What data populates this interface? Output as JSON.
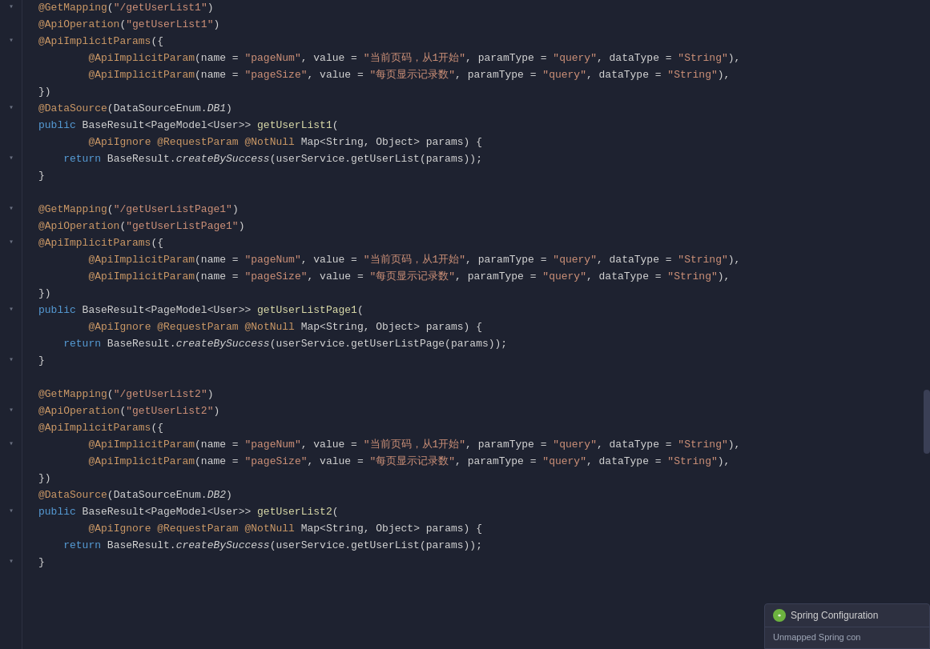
{
  "editor": {
    "background": "#1e2230",
    "lines": [
      {
        "id": 1,
        "fold": true,
        "tokens": [
          {
            "t": "annotation-name",
            "v": "@GetMapping"
          },
          {
            "t": "plain",
            "v": "("
          },
          {
            "t": "string",
            "v": "\""
          },
          {
            "t": "string",
            "v": "/getUserList1"
          },
          {
            "t": "string",
            "v": "\""
          },
          {
            "t": "plain",
            "v": ")"
          }
        ]
      },
      {
        "id": 2,
        "fold": false,
        "tokens": [
          {
            "t": "annotation-name",
            "v": "@ApiOperation"
          },
          {
            "t": "plain",
            "v": "("
          },
          {
            "t": "string",
            "v": "\""
          },
          {
            "t": "string",
            "v": "getUserList1"
          },
          {
            "t": "string",
            "v": "\""
          },
          {
            "t": "plain",
            "v": ")"
          }
        ]
      },
      {
        "id": 3,
        "fold": true,
        "tokens": [
          {
            "t": "annotation-name",
            "v": "@ApiImplicitParams"
          },
          {
            "t": "plain",
            "v": "({"
          }
        ]
      },
      {
        "id": 4,
        "fold": false,
        "tokens": [
          {
            "t": "plain",
            "v": "        "
          },
          {
            "t": "annotation-name",
            "v": "@ApiImplicitParam"
          },
          {
            "t": "plain",
            "v": "(name = "
          },
          {
            "t": "string",
            "v": "\"pageNum\""
          },
          {
            "t": "plain",
            "v": ", value = "
          },
          {
            "t": "cn-string",
            "v": "\"当前页码，从1开始\""
          },
          {
            "t": "plain",
            "v": ", paramType = "
          },
          {
            "t": "string",
            "v": "\"query\""
          },
          {
            "t": "plain",
            "v": ", dataType = "
          },
          {
            "t": "string",
            "v": "\"String\""
          },
          {
            "t": "plain",
            "v": ")，"
          }
        ]
      },
      {
        "id": 5,
        "fold": false,
        "tokens": [
          {
            "t": "plain",
            "v": "        "
          },
          {
            "t": "annotation-name",
            "v": "@ApiImplicitParam"
          },
          {
            "t": "plain",
            "v": "(name = "
          },
          {
            "t": "string",
            "v": "\"pageSize\""
          },
          {
            "t": "plain",
            "v": ", value = "
          },
          {
            "t": "cn-string",
            "v": "\"每页显示记录数\""
          },
          {
            "t": "plain",
            "v": ", paramType = "
          },
          {
            "t": "string",
            "v": "\"query\""
          },
          {
            "t": "plain",
            "v": ", dataType = "
          },
          {
            "t": "string",
            "v": "\"String\""
          },
          {
            "t": "plain",
            "v": ")，"
          }
        ]
      },
      {
        "id": 6,
        "fold": false,
        "tokens": [
          {
            "t": "plain",
            "v": "})"
          }
        ]
      },
      {
        "id": 7,
        "fold": false,
        "tokens": [
          {
            "t": "annotation-name",
            "v": "@DataSource"
          },
          {
            "t": "plain",
            "v": "(DataSourceEnum."
          },
          {
            "t": "italic",
            "v": "DB1"
          },
          {
            "t": "plain",
            "v": ")"
          }
        ]
      },
      {
        "id": 8,
        "fold": true,
        "tokens": [
          {
            "t": "keyword",
            "v": "public"
          },
          {
            "t": "plain",
            "v": " BaseResult<PageModel<User>> "
          },
          {
            "t": "method",
            "v": "getUserList1"
          },
          {
            "t": "plain",
            "v": "("
          }
        ]
      },
      {
        "id": 9,
        "fold": false,
        "tokens": [
          {
            "t": "plain",
            "v": "        "
          },
          {
            "t": "annotation-name",
            "v": "@ApiIgnore"
          },
          {
            "t": "plain",
            "v": " "
          },
          {
            "t": "annotation-name",
            "v": "@RequestParam"
          },
          {
            "t": "plain",
            "v": " "
          },
          {
            "t": "annotation-name",
            "v": "@NotNull"
          },
          {
            "t": "plain",
            "v": " Map<String, Object> params) {"
          }
        ]
      },
      {
        "id": 10,
        "fold": false,
        "tokens": [
          {
            "t": "plain",
            "v": "    "
          },
          {
            "t": "keyword",
            "v": "return"
          },
          {
            "t": "plain",
            "v": " BaseResult."
          },
          {
            "t": "italic",
            "v": "createBySuccess"
          },
          {
            "t": "plain",
            "v": "(userService.getUserList(params));"
          }
        ]
      },
      {
        "id": 11,
        "fold": false,
        "tokens": [
          {
            "t": "plain",
            "v": "}"
          }
        ]
      },
      {
        "id": 12,
        "fold": false,
        "tokens": []
      },
      {
        "id": 13,
        "fold": true,
        "tokens": [
          {
            "t": "annotation-name",
            "v": "@GetMapping"
          },
          {
            "t": "plain",
            "v": "("
          },
          {
            "t": "string",
            "v": "\""
          },
          {
            "t": "string",
            "v": "/getUserListPage1"
          },
          {
            "t": "string",
            "v": "\""
          },
          {
            "t": "plain",
            "v": ")"
          }
        ]
      },
      {
        "id": 14,
        "fold": false,
        "tokens": [
          {
            "t": "annotation-name",
            "v": "@ApiOperation"
          },
          {
            "t": "plain",
            "v": "("
          },
          {
            "t": "string",
            "v": "\""
          },
          {
            "t": "string",
            "v": "getUserListPage1"
          },
          {
            "t": "string",
            "v": "\""
          },
          {
            "t": "plain",
            "v": ")"
          }
        ]
      },
      {
        "id": 15,
        "fold": true,
        "tokens": [
          {
            "t": "annotation-name",
            "v": "@ApiImplicitParams"
          },
          {
            "t": "plain",
            "v": "({"
          }
        ]
      },
      {
        "id": 16,
        "fold": false,
        "tokens": [
          {
            "t": "plain",
            "v": "        "
          },
          {
            "t": "annotation-name",
            "v": "@ApiImplicitParam"
          },
          {
            "t": "plain",
            "v": "(name = "
          },
          {
            "t": "string",
            "v": "\"pageNum\""
          },
          {
            "t": "plain",
            "v": ", value = "
          },
          {
            "t": "cn-string",
            "v": "\"当前页码，从1开始\""
          },
          {
            "t": "plain",
            "v": ", paramType = "
          },
          {
            "t": "string",
            "v": "\"query\""
          },
          {
            "t": "plain",
            "v": ", dataType = "
          },
          {
            "t": "string",
            "v": "\"String\""
          },
          {
            "t": "plain",
            "v": ")，"
          }
        ]
      },
      {
        "id": 17,
        "fold": false,
        "tokens": [
          {
            "t": "plain",
            "v": "        "
          },
          {
            "t": "annotation-name",
            "v": "@ApiImplicitParam"
          },
          {
            "t": "plain",
            "v": "(name = "
          },
          {
            "t": "string",
            "v": "\"pageSize\""
          },
          {
            "t": "plain",
            "v": ", value = "
          },
          {
            "t": "cn-string",
            "v": "\"每页显示记录数\""
          },
          {
            "t": "plain",
            "v": ", paramType = "
          },
          {
            "t": "string",
            "v": "\"query\""
          },
          {
            "t": "plain",
            "v": ", dataType = "
          },
          {
            "t": "string",
            "v": "\"String\""
          },
          {
            "t": "plain",
            "v": ")，"
          }
        ]
      },
      {
        "id": 18,
        "fold": false,
        "tokens": [
          {
            "t": "plain",
            "v": "})"
          }
        ]
      },
      {
        "id": 19,
        "fold": true,
        "tokens": [
          {
            "t": "keyword",
            "v": "public"
          },
          {
            "t": "plain",
            "v": " BaseResult<PageModel<User>> "
          },
          {
            "t": "method",
            "v": "getUserListPage1"
          },
          {
            "t": "plain",
            "v": "("
          }
        ]
      },
      {
        "id": 20,
        "fold": false,
        "tokens": [
          {
            "t": "plain",
            "v": "        "
          },
          {
            "t": "annotation-name",
            "v": "@ApiIgnore"
          },
          {
            "t": "plain",
            "v": " "
          },
          {
            "t": "annotation-name",
            "v": "@RequestParam"
          },
          {
            "t": "plain",
            "v": " "
          },
          {
            "t": "annotation-name",
            "v": "@NotNull"
          },
          {
            "t": "plain",
            "v": " Map<String, Object> params) {"
          }
        ]
      },
      {
        "id": 21,
        "fold": false,
        "tokens": [
          {
            "t": "plain",
            "v": "    "
          },
          {
            "t": "keyword",
            "v": "return"
          },
          {
            "t": "plain",
            "v": " BaseResult."
          },
          {
            "t": "italic",
            "v": "createBySuccess"
          },
          {
            "t": "plain",
            "v": "(userService.getUserListPage(params));"
          }
        ]
      },
      {
        "id": 22,
        "fold": false,
        "tokens": [
          {
            "t": "plain",
            "v": "}"
          }
        ]
      },
      {
        "id": 23,
        "fold": false,
        "tokens": []
      },
      {
        "id": 24,
        "fold": true,
        "tokens": [
          {
            "t": "annotation-name",
            "v": "@GetMapping"
          },
          {
            "t": "plain",
            "v": "("
          },
          {
            "t": "string",
            "v": "\""
          },
          {
            "t": "string",
            "v": "/getUserList2"
          },
          {
            "t": "string",
            "v": "\""
          },
          {
            "t": "plain",
            "v": ")"
          }
        ]
      },
      {
        "id": 25,
        "fold": false,
        "tokens": [
          {
            "t": "annotation-name",
            "v": "@ApiOperation"
          },
          {
            "t": "plain",
            "v": "("
          },
          {
            "t": "string",
            "v": "\""
          },
          {
            "t": "string",
            "v": "getUserList2"
          },
          {
            "t": "string",
            "v": "\""
          },
          {
            "t": "plain",
            "v": ")"
          }
        ]
      },
      {
        "id": 26,
        "fold": true,
        "tokens": [
          {
            "t": "annotation-name",
            "v": "@ApiImplicitParams"
          },
          {
            "t": "plain",
            "v": "({"
          }
        ]
      },
      {
        "id": 27,
        "fold": false,
        "tokens": [
          {
            "t": "plain",
            "v": "        "
          },
          {
            "t": "annotation-name",
            "v": "@ApiImplicitParam"
          },
          {
            "t": "plain",
            "v": "(name = "
          },
          {
            "t": "string",
            "v": "\"pageNum\""
          },
          {
            "t": "plain",
            "v": ", value = "
          },
          {
            "t": "cn-string",
            "v": "\"当前页码，从1开始\""
          },
          {
            "t": "plain",
            "v": ", paramType = "
          },
          {
            "t": "string",
            "v": "\"query\""
          },
          {
            "t": "plain",
            "v": ", dataType = "
          },
          {
            "t": "string",
            "v": "\"String\""
          },
          {
            "t": "plain",
            "v": ")，"
          }
        ]
      },
      {
        "id": 28,
        "fold": false,
        "tokens": [
          {
            "t": "plain",
            "v": "        "
          },
          {
            "t": "annotation-name",
            "v": "@ApiImplicitParam"
          },
          {
            "t": "plain",
            "v": "(name = "
          },
          {
            "t": "string",
            "v": "\"pageSize\""
          },
          {
            "t": "plain",
            "v": ", value = "
          },
          {
            "t": "cn-string",
            "v": "\"每页显示记录数\""
          },
          {
            "t": "plain",
            "v": ", paramType = "
          },
          {
            "t": "string",
            "v": "\"query\""
          },
          {
            "t": "plain",
            "v": ", dataType = "
          },
          {
            "t": "string",
            "v": "\"String\""
          },
          {
            "t": "plain",
            "v": ")，"
          }
        ]
      },
      {
        "id": 29,
        "fold": false,
        "tokens": [
          {
            "t": "plain",
            "v": "})"
          }
        ]
      },
      {
        "id": 30,
        "fold": false,
        "tokens": [
          {
            "t": "annotation-name",
            "v": "@DataSource"
          },
          {
            "t": "plain",
            "v": "(DataSourceEnum."
          },
          {
            "t": "italic",
            "v": "DB2"
          },
          {
            "t": "plain",
            "v": ")"
          }
        ]
      },
      {
        "id": 31,
        "fold": true,
        "tokens": [
          {
            "t": "keyword",
            "v": "public"
          },
          {
            "t": "plain",
            "v": " BaseResult<PageModel<User>> "
          },
          {
            "t": "method",
            "v": "getUserList2"
          },
          {
            "t": "plain",
            "v": "("
          }
        ]
      },
      {
        "id": 32,
        "fold": false,
        "tokens": [
          {
            "t": "plain",
            "v": "        "
          },
          {
            "t": "annotation-name",
            "v": "@ApiIgnore"
          },
          {
            "t": "plain",
            "v": " "
          },
          {
            "t": "annotation-name",
            "v": "@RequestParam"
          },
          {
            "t": "plain",
            "v": " "
          },
          {
            "t": "annotation-name",
            "v": "@NotNull"
          },
          {
            "t": "plain",
            "v": " Map<String, Object> params) {"
          }
        ]
      },
      {
        "id": 33,
        "fold": false,
        "tokens": [
          {
            "t": "plain",
            "v": "    "
          },
          {
            "t": "keyword",
            "v": "return"
          },
          {
            "t": "plain",
            "v": " BaseResult."
          },
          {
            "t": "italic",
            "v": "createBySuccess"
          },
          {
            "t": "plain",
            "v": "(userService.getUserList(params));"
          }
        ]
      },
      {
        "id": 34,
        "fold": false,
        "tokens": [
          {
            "t": "plain",
            "v": "}"
          }
        ]
      }
    ],
    "fold_positions": [
      0,
      2,
      7,
      12,
      14,
      18,
      23,
      25,
      30
    ],
    "spring_panel": {
      "title": "Spring Configuration",
      "body": "Unmapped Spring con",
      "icon_color": "#6db33f"
    }
  }
}
